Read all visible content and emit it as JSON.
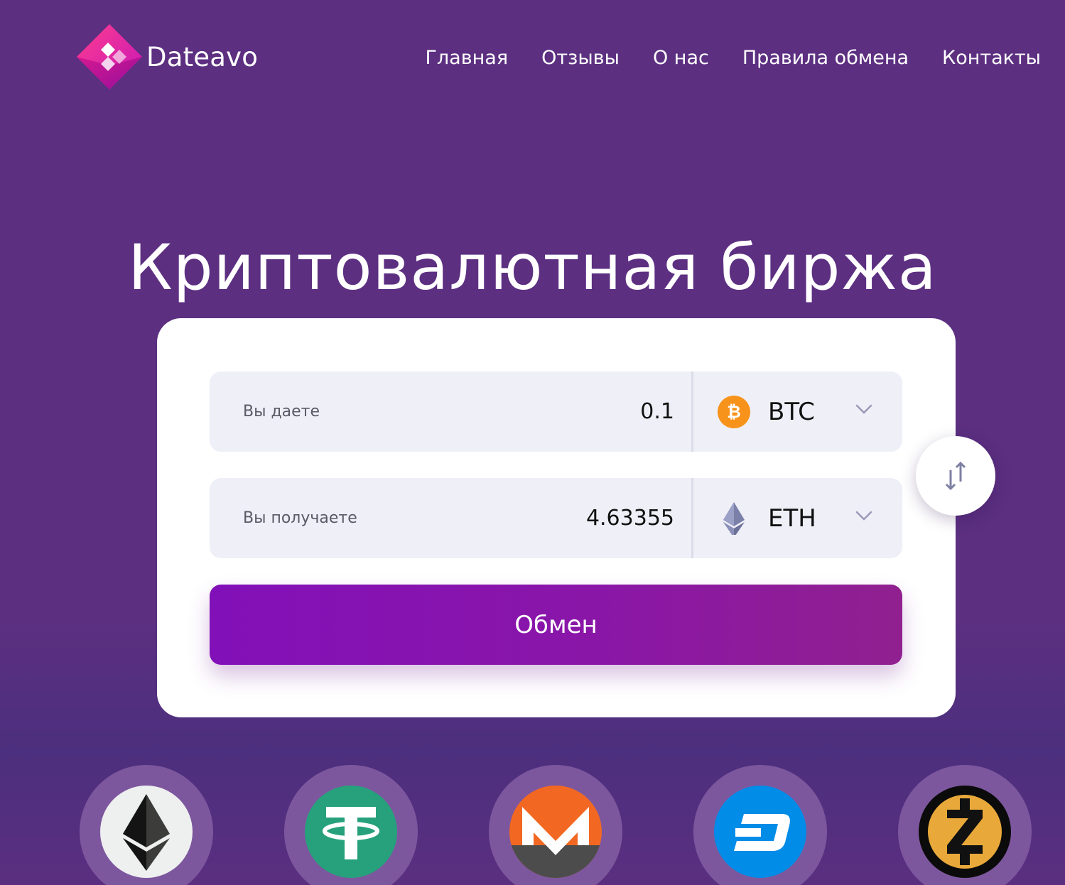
{
  "brand": {
    "name": "Dateavo"
  },
  "nav": {
    "items": [
      "Главная",
      "Отзывы",
      "О нас",
      "Правила обмена",
      "Контакты"
    ]
  },
  "hero": {
    "title": "Криптовалютная биржа"
  },
  "exchange": {
    "give": {
      "label": "Вы даете",
      "amount": "0.1",
      "currency": "BTC",
      "icon": "bitcoin-icon"
    },
    "get": {
      "label": "Вы получаете",
      "amount": "4.63355",
      "currency": "ETH",
      "icon": "ethereum-icon"
    },
    "button_label": "Обмен"
  },
  "coins": [
    "ethereum-icon",
    "tether-icon",
    "monero-icon",
    "dash-icon",
    "zcash-icon"
  ],
  "colors": {
    "background": "#5c2f81",
    "button": "#8210b8",
    "bitcoin": "#f7931a",
    "card": "#ffffff"
  }
}
